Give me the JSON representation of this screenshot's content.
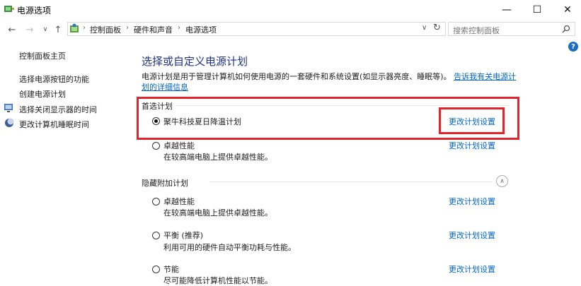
{
  "window": {
    "title": "电源选项",
    "minimize": "—",
    "maximize": "☐",
    "close": "✕"
  },
  "address": {
    "crumbs": [
      "控制面板",
      "硬件和声音",
      "电源选项"
    ],
    "search_placeholder": "搜索控制面板"
  },
  "sidebar": {
    "home": "控制面板主页",
    "items": [
      "选择电源按钮的功能",
      "创建电源计划",
      "选择关闭显示器的时间",
      "更改计算机睡眠时间"
    ]
  },
  "main": {
    "heading": "选择或自定义电源计划",
    "desc_text": "电源计划是用于管理计算机如何使用电源的一套硬件和系统设置(如显示器亮度、睡眠等)。",
    "desc_link": "告诉我有关电源计划的详细信息",
    "preferred_label": "首选计划",
    "hidden_label": "隐藏附加计划",
    "change_label": "更改计划设置",
    "preferred_plans": [
      {
        "name": "聚牛科技夏日降温计划",
        "desc": "",
        "selected": true
      },
      {
        "name": "卓越性能",
        "desc": "在较高端电脑上提供卓越性能。",
        "selected": false
      }
    ],
    "hidden_plans": [
      {
        "name": "卓越性能",
        "desc": "在较高端电脑上提供卓越性能。",
        "selected": false
      },
      {
        "name": "平衡 (推荐)",
        "desc": "利用可用的硬件自动平衡功耗与性能。",
        "selected": false
      },
      {
        "name": "节能",
        "desc": "尽可能降低计算机性能以节能。",
        "selected": false
      }
    ]
  },
  "colors": {
    "heading": "#1e3287",
    "link": "#0066cc",
    "highlight": "#e0262c"
  }
}
